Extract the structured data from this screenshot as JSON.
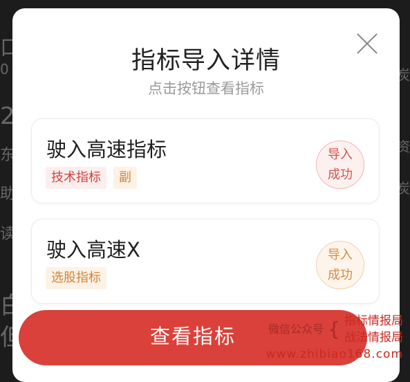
{
  "background": {
    "left_glyphs": [
      "口",
      "0",
      "2",
      "东",
      "助",
      "读",
      "白",
      "但"
    ],
    "right_glyphs": [
      "资",
      "炭",
      "炭"
    ]
  },
  "dialog": {
    "title": "指标导入详情",
    "subtitle": "点击按钮查看指标",
    "close_icon": "close-icon",
    "cards": [
      {
        "name": "驶入高速指标",
        "tags": [
          {
            "label": "技术指标",
            "color": "#d0433c"
          },
          {
            "label": "副",
            "color": "#d2843a"
          }
        ],
        "status_line1": "导入",
        "status_line2": "成功",
        "status_color": "#d0544c"
      },
      {
        "name": "驶入高速X",
        "tags": [
          {
            "label": "选股指标",
            "color": "#d2843a"
          }
        ],
        "status_line1": "导入",
        "status_line2": "成功",
        "status_color": "#d88a42"
      }
    ],
    "button_label": "查看指标"
  },
  "watermark": {
    "wechat": "微信公众号",
    "brace": "{",
    "name1": "指标情报局",
    "name2": "战法情报局",
    "url": "www.zhibiao168.com"
  }
}
